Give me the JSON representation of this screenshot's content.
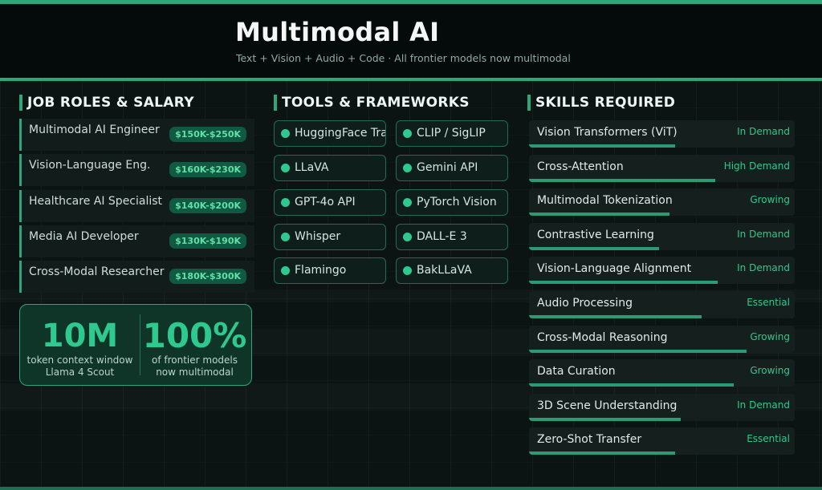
{
  "header": {
    "title": "Multimodal AI",
    "subtitle": "Text + Vision + Audio + Code  ·  All frontier models now multimodal"
  },
  "sections": {
    "roles": "JOB ROLES & SALARY",
    "tools": "TOOLS & FRAMEWORKS",
    "skills": "SKILLS REQUIRED"
  },
  "roles": [
    {
      "name": "Multimodal AI Engineer",
      "salary": "$150K-$250K"
    },
    {
      "name": "Vision-Language Eng.",
      "salary": "$160K-$230K"
    },
    {
      "name": "Healthcare AI Specialist",
      "salary": "$140K-$200K"
    },
    {
      "name": "Media AI Developer",
      "salary": "$130K-$190K"
    },
    {
      "name": "Cross-Modal Researcher",
      "salary": "$180K-$300K"
    }
  ],
  "stats": [
    {
      "value": "10M",
      "label1": "token context window",
      "label2": "Llama 4 Scout"
    },
    {
      "value": "100%",
      "label1": "of frontier models",
      "label2": "now multimodal"
    }
  ],
  "tools": [
    "HuggingFace Transformers",
    "CLIP / SigLIP",
    "LLaVA",
    "Gemini API",
    "GPT-4o API",
    "PyTorch Vision",
    "Whisper",
    "DALL-E 3",
    "Flamingo",
    "BakLLaVA"
  ],
  "skills": [
    {
      "name": "Vision Transformers (ViT)",
      "status": "In Demand",
      "level": 0.55
    },
    {
      "name": "Cross-Attention",
      "status": "High Demand",
      "level": 0.7
    },
    {
      "name": "Multimodal Tokenization",
      "status": "Growing",
      "level": 0.53
    },
    {
      "name": "Contrastive Learning",
      "status": "In Demand",
      "level": 0.49
    },
    {
      "name": "Vision-Language Alignment",
      "status": "In Demand",
      "level": 0.71
    },
    {
      "name": "Audio Processing",
      "status": "Essential",
      "level": 0.65
    },
    {
      "name": "Cross-Modal Reasoning",
      "status": "Growing",
      "level": 0.82
    },
    {
      "name": "Data Curation",
      "status": "Growing",
      "level": 0.77
    },
    {
      "name": "3D Scene Understanding",
      "status": "In Demand",
      "level": 0.57
    },
    {
      "name": "Zero-Shot Transfer",
      "status": "Essential",
      "level": 0.55
    }
  ],
  "colors": {
    "accent": "#2ba77a",
    "accent_bright": "#2ec98e",
    "salary_bg": "#0f5a40"
  }
}
